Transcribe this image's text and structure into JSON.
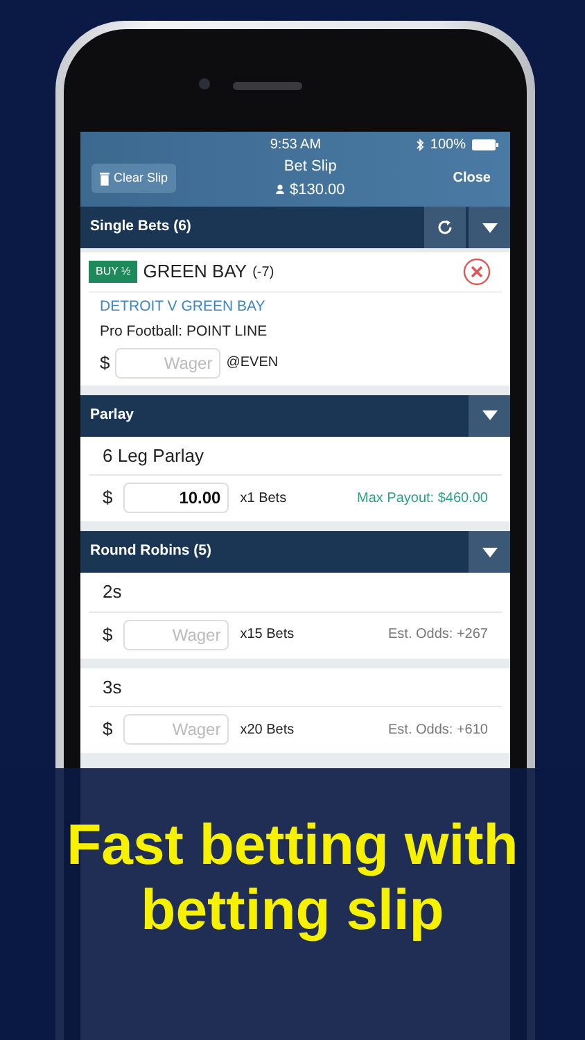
{
  "status_bar": {
    "time": "9:53 AM",
    "battery": "100%"
  },
  "header": {
    "clear_button": "Clear Slip",
    "title": "Bet Slip",
    "balance": "$130.00",
    "close_button": "Close"
  },
  "single_bets": {
    "title": "Single Bets (6)",
    "bets": [
      {
        "tag": "BUY ½",
        "team": "GREEN BAY",
        "line": "(-7)",
        "event": "DETROIT V GREEN BAY",
        "market": "Pro Football: POINT LINE",
        "currency": "$",
        "placeholder": "Wager",
        "odds": "@EVEN"
      }
    ]
  },
  "parlay": {
    "title": "Parlay",
    "items": [
      {
        "name": "6 Leg Parlay",
        "currency": "$",
        "value": "10.00",
        "count": "x1 Bets",
        "info": "Max Payout: $460.00",
        "kind": "payout"
      }
    ]
  },
  "round_robins": {
    "title": "Round Robins (5)",
    "items": [
      {
        "name": "2s",
        "currency": "$",
        "placeholder": "Wager",
        "count": "x15 Bets",
        "info": "Est. Odds: +267",
        "kind": "odds"
      },
      {
        "name": "3s",
        "currency": "$",
        "placeholder": "Wager",
        "count": "x20 Bets",
        "info": "Est. Odds: +610",
        "kind": "odds"
      }
    ]
  },
  "banner": {
    "line_1": "Fast betting with",
    "line_2": "betting slip"
  }
}
